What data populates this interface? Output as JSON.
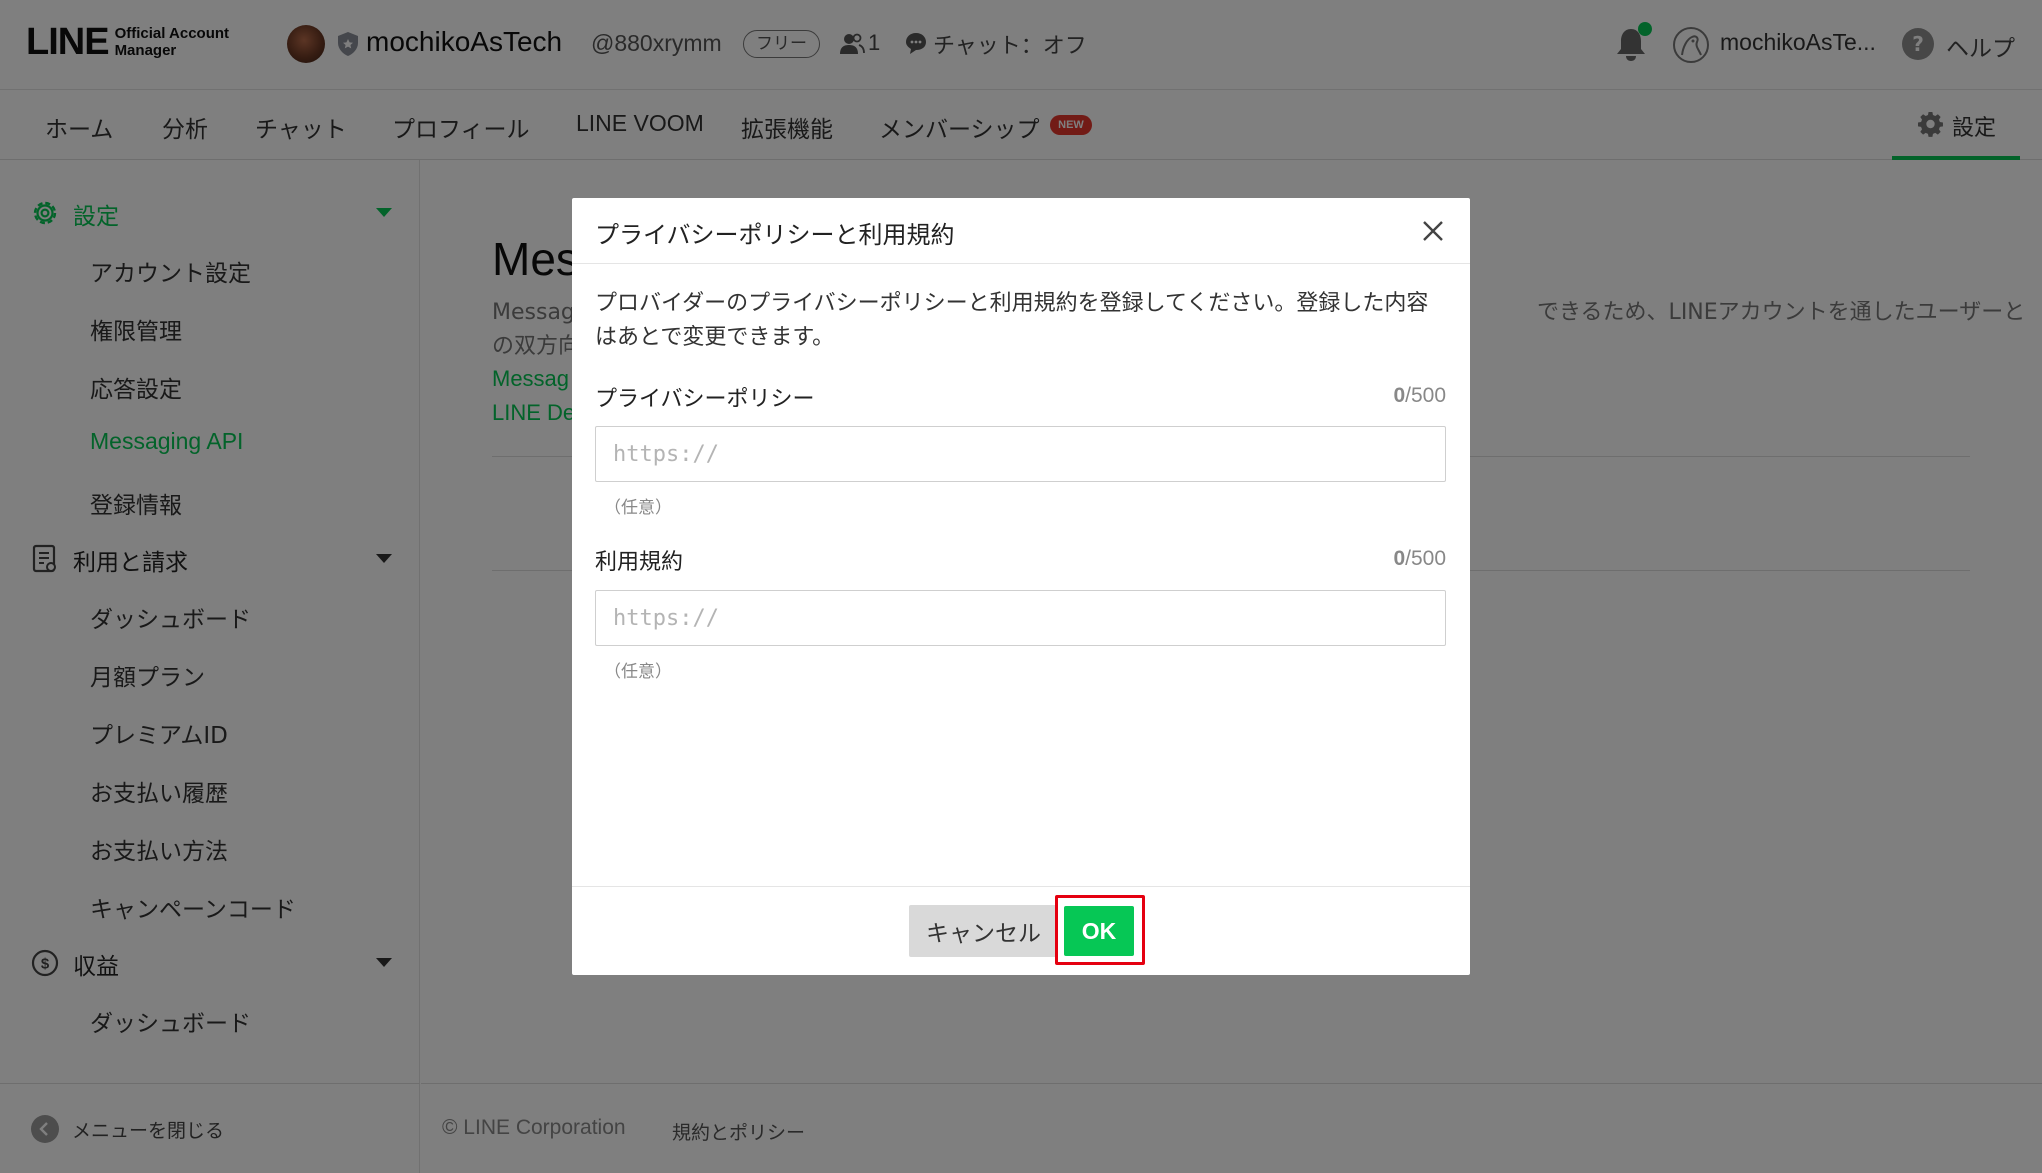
{
  "header": {
    "logo_main": "LINE",
    "logo_sub_1": "Official Account",
    "logo_sub_2": "Manager",
    "account_name": "mochikoAsTech",
    "account_id": "@880xrymm",
    "plan_badge": "フリー",
    "friends_count": "1",
    "chat_status": "チャット：オフ",
    "user_name": "mochikoAsTe...",
    "help_glyph": "?",
    "help_label": "ヘルプ",
    "notification_dot_color": "#06c755"
  },
  "nav": {
    "tabs": [
      {
        "label": "ホーム"
      },
      {
        "label": "分析"
      },
      {
        "label": "チャット"
      },
      {
        "label": "プロフィール"
      },
      {
        "label": "LINE VOOM"
      },
      {
        "label": "拡張機能"
      },
      {
        "label": "メンバーシップ"
      }
    ],
    "new_badge": "NEW",
    "settings_label": "設定",
    "active_tab": "設定"
  },
  "sidebar": {
    "sections": [
      {
        "label": "設定",
        "icon": "gear-icon",
        "items": [
          "アカウント設定",
          "権限管理",
          "応答設定",
          "Messaging API",
          "登録情報"
        ]
      },
      {
        "label": "利用と請求",
        "icon": "document-icon",
        "items": [
          "ダッシュボード",
          "月額プラン",
          "プレミアムID",
          "お支払い履歴",
          "お支払い方法",
          "キャンペーンコード"
        ]
      },
      {
        "label": "収益",
        "icon": "dollar-coin-icon",
        "items": [
          "ダッシュボード"
        ]
      }
    ],
    "active_item": "Messaging API",
    "collapse_label": "メニューを閉じる"
  },
  "main": {
    "title_fragment": "Mes",
    "desc_line1_start": "Messag",
    "desc_line1_end": "できるため、LINEアカウントを通したユーザーと",
    "desc_line2_start": "の双方向",
    "link1": "Messag",
    "link2": "LINE De",
    "copyright": "© LINE Corporation",
    "footer_link": "規約とポリシー"
  },
  "modal": {
    "title": "プライバシーポリシーと利用規約",
    "description": "プロバイダーのプライバシーポリシーと利用規約を登録してください。登録した内容はあとで変更できます。",
    "fields": [
      {
        "label": "プライバシーポリシー",
        "count": "0",
        "max": "/500",
        "value": "",
        "placeholder": "https://",
        "hint": "（任意）"
      },
      {
        "label": "利用規約",
        "count": "0",
        "max": "/500",
        "value": "",
        "placeholder": "https://",
        "hint": "（任意）"
      }
    ],
    "cancel_label": "キャンセル",
    "ok_label": "OK",
    "accent_color": "#06c755",
    "highlight_color": "#e50010"
  }
}
